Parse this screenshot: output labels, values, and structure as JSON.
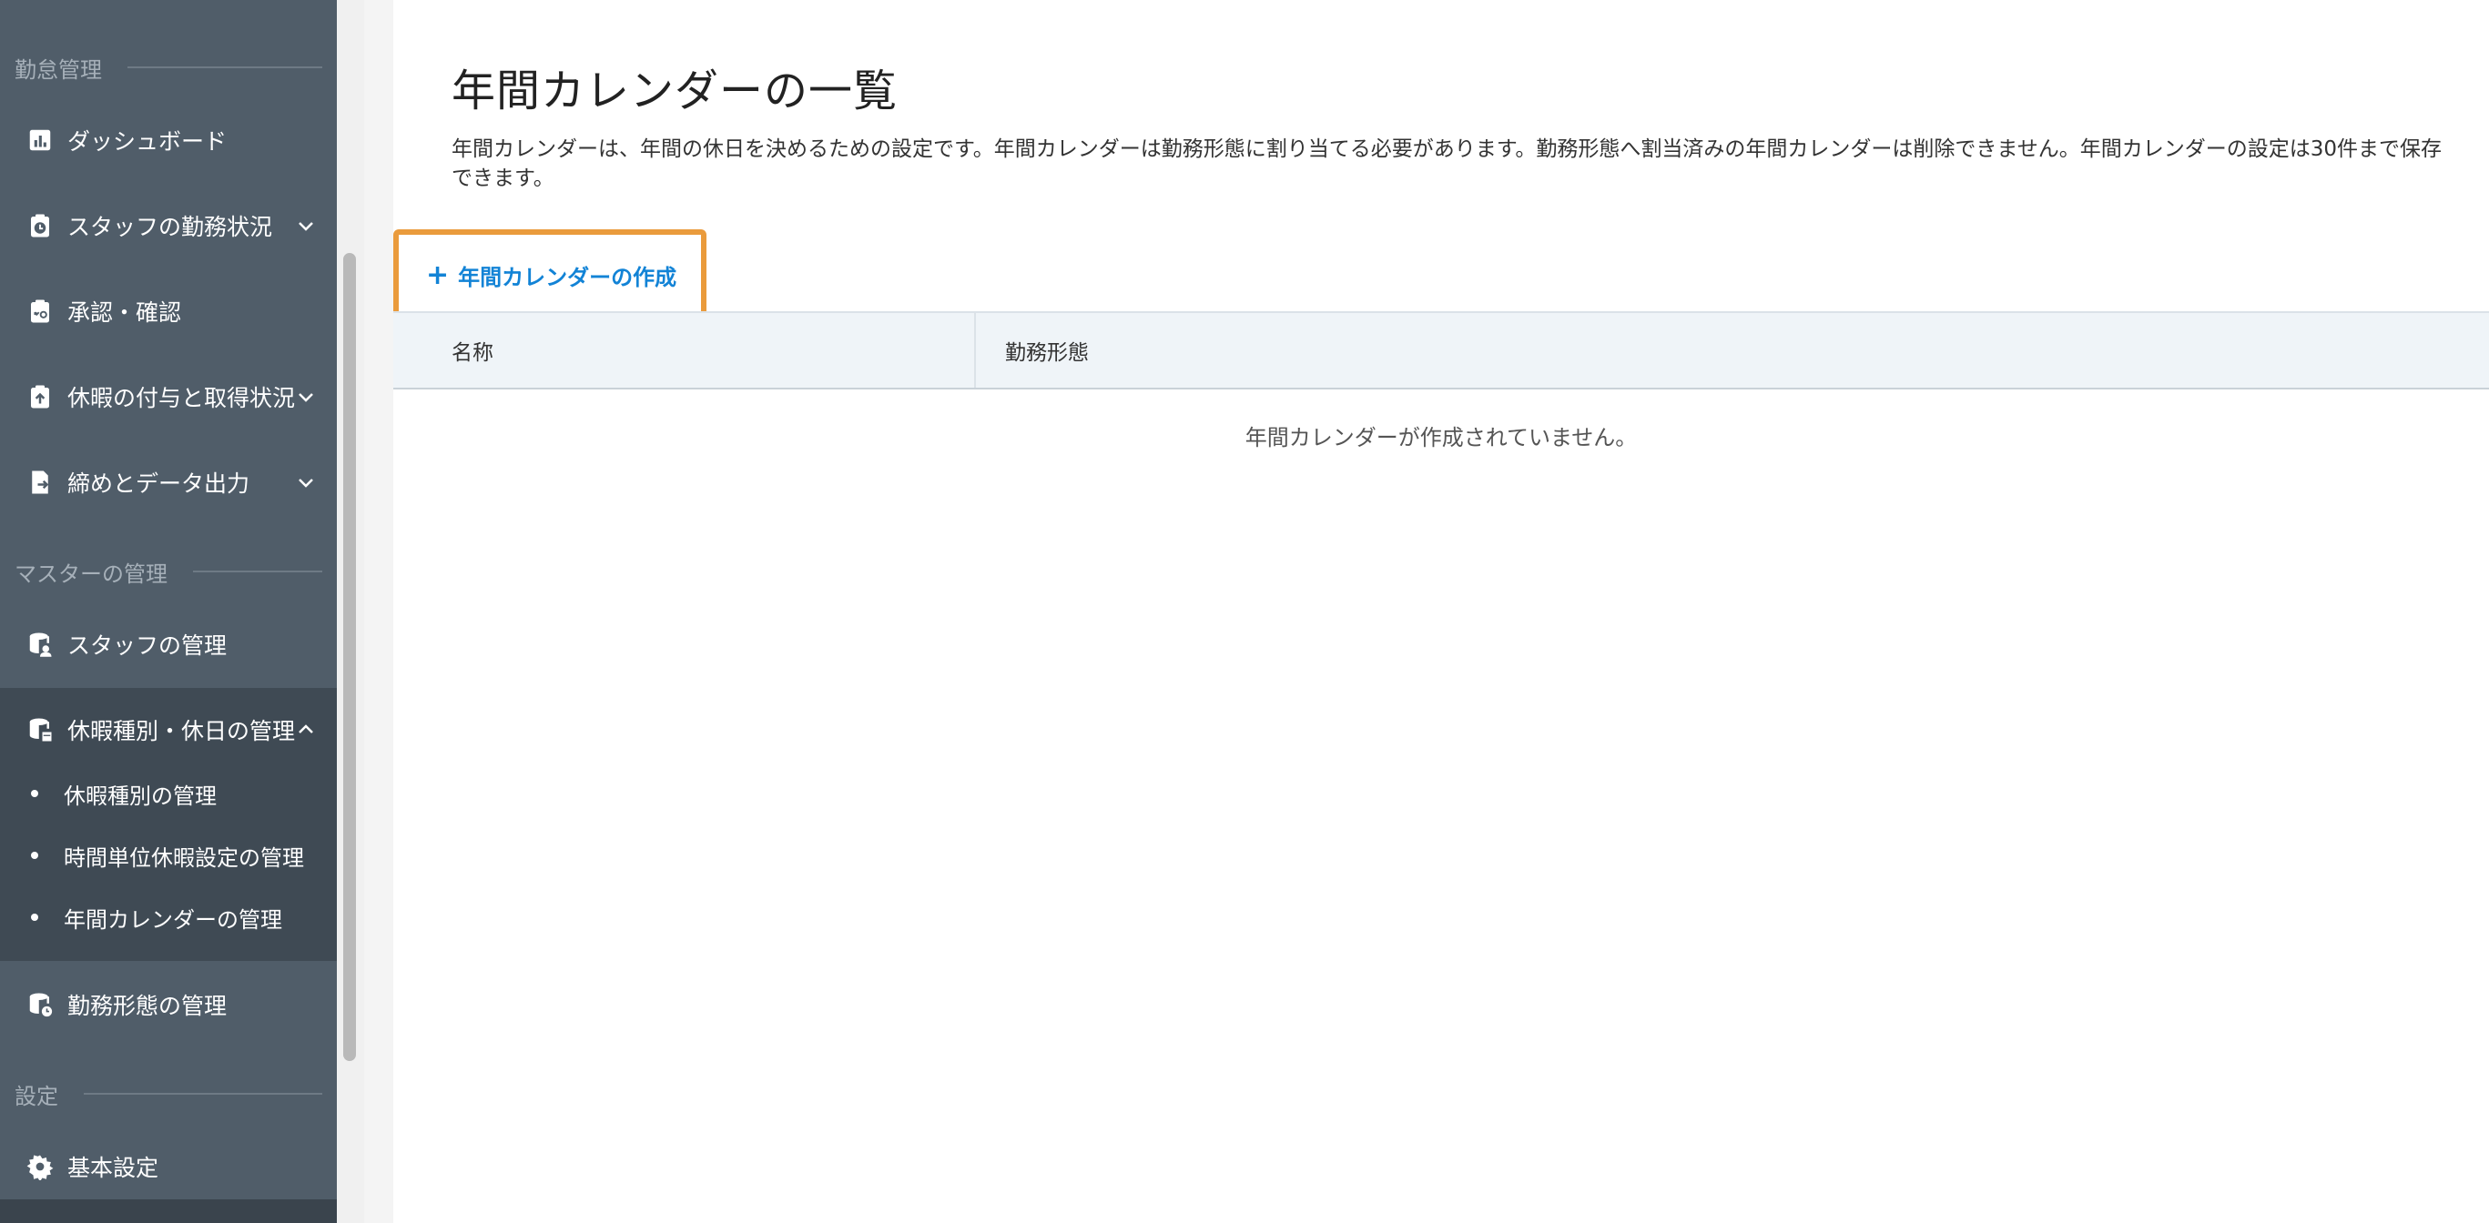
{
  "sidebar": {
    "sections": {
      "attendance": "勤怠管理",
      "master": "マスターの管理",
      "settings": "設定"
    },
    "items": {
      "dashboard": "ダッシュボード",
      "staff_status": "スタッフの勤務状況",
      "approval": "承認・確認",
      "leave_grant": "休暇の付与と取得状況",
      "closing_export": "締めとデータ出力",
      "staff_manage": "スタッフの管理",
      "leave_types": "休暇種別・休日の管理",
      "work_pattern": "勤務形態の管理",
      "basic_settings": "基本設定"
    },
    "subitems": {
      "leave_type_manage": "休暇種別の管理",
      "hourly_leave": "時間単位休暇設定の管理",
      "annual_calendar": "年間カレンダーの管理"
    }
  },
  "main": {
    "title": "年間カレンダーの一覧",
    "description": "年間カレンダーは、年間の休日を決めるための設定です。年間カレンダーは勤務形態に割り当てる必要があります。勤務形態へ割当済みの年間カレンダーは削除できません。年間カレンダーの設定は30件まで保存できます。",
    "create_button": "年間カレンダーの作成",
    "create_icon": "+",
    "table": {
      "columns": [
        "名称",
        "勤務形態"
      ],
      "empty_message": "年間カレンダーが作成されていません。"
    }
  },
  "colors": {
    "sidebar_bg": "#505d69",
    "sidebar_expanded_bg": "#3f4a54",
    "accent": "#1283d6",
    "highlight": "#ea9b3c"
  }
}
